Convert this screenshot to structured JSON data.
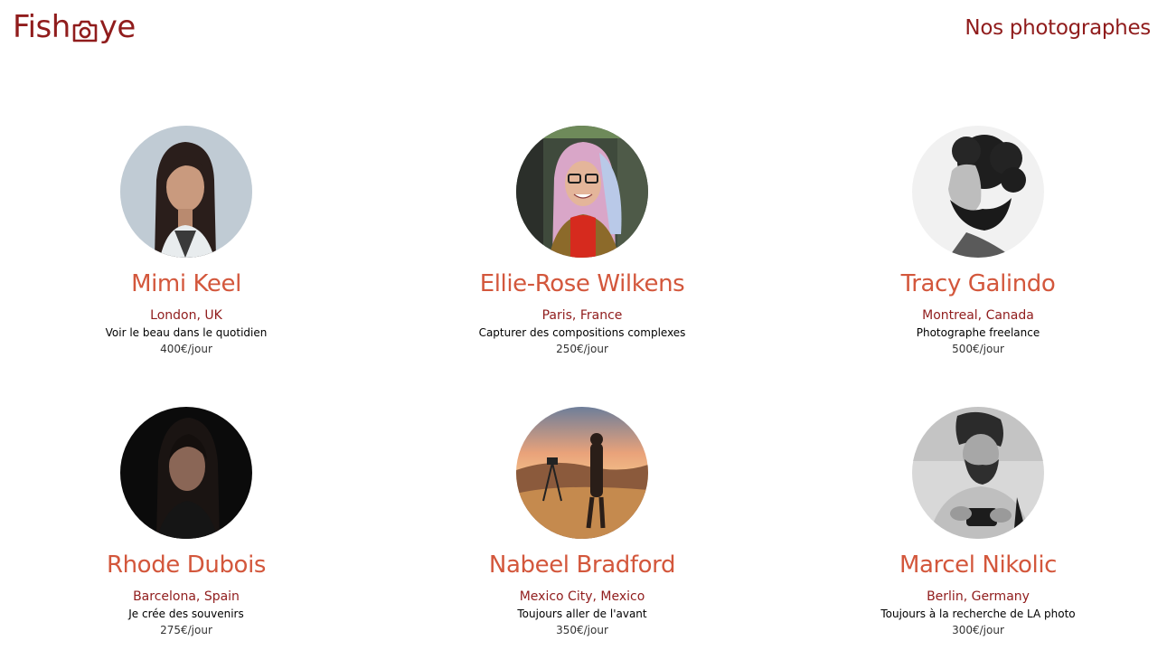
{
  "header": {
    "logo_left": "Fish",
    "logo_right": "ye",
    "logo_icon": "camera-icon",
    "page_heading": "Nos photographes"
  },
  "photographers": [
    {
      "name": "Mimi Keel",
      "location": "London, UK",
      "tagline": "Voir le beau dans le quotidien",
      "price": "400€/jour"
    },
    {
      "name": "Ellie-Rose Wilkens",
      "location": "Paris, France",
      "tagline": "Capturer des compositions complexes",
      "price": "250€/jour"
    },
    {
      "name": "Tracy Galindo",
      "location": "Montreal, Canada",
      "tagline": "Photographe freelance",
      "price": "500€/jour"
    },
    {
      "name": "Rhode Dubois",
      "location": "Barcelona, Spain",
      "tagline": "Je crée des souvenirs",
      "price": "275€/jour"
    },
    {
      "name": "Nabeel Bradford",
      "location": "Mexico City, Mexico",
      "tagline": "Toujours aller de l'avant",
      "price": "350€/jour"
    },
    {
      "name": "Marcel Nikolic",
      "location": "Berlin, Germany",
      "tagline": "Toujours à la recherche de LA photo",
      "price": "300€/jour"
    }
  ],
  "colors": {
    "brand": "#901C1C",
    "accent": "#D3573C"
  }
}
